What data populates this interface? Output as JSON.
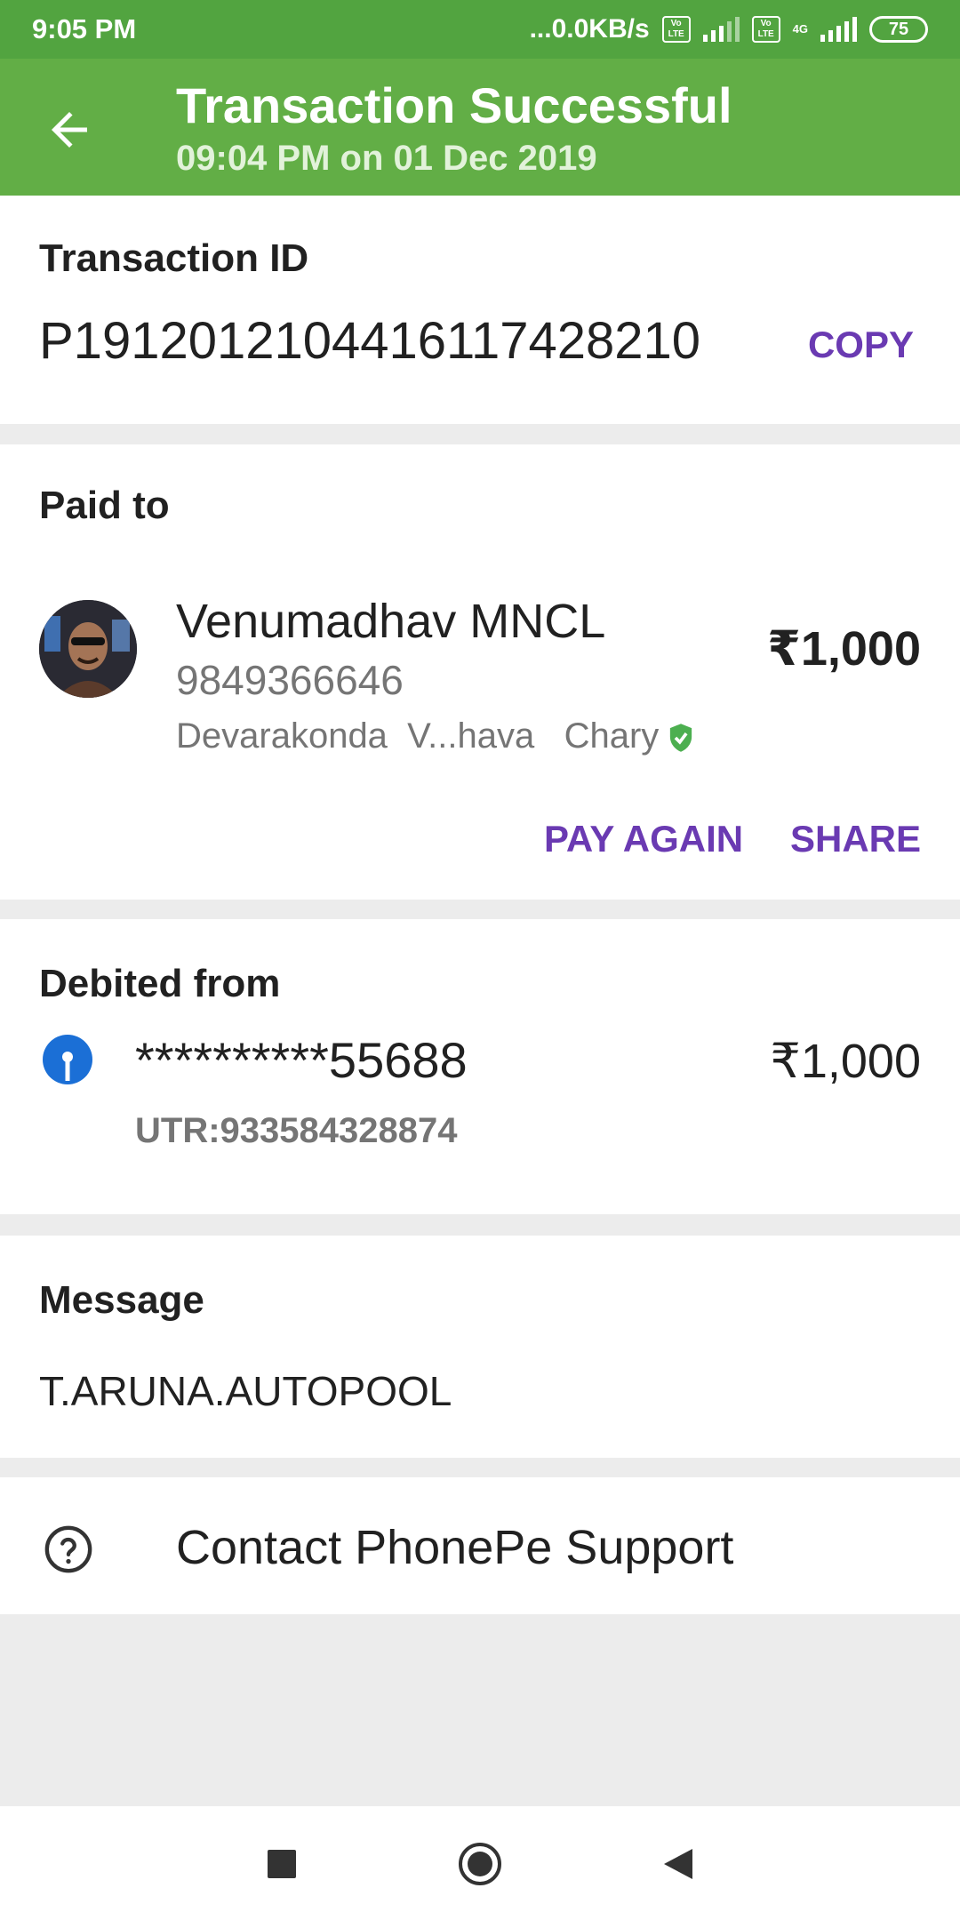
{
  "status_bar": {
    "time": "9:05 PM",
    "net_speed": "...0.0KB/s",
    "sim1_tag": "Vo LTE",
    "sim2_tag": "Vo LTE",
    "network_type": "4G",
    "battery": "75"
  },
  "header": {
    "title": "Transaction Successful",
    "subtitle": "09:04 PM on 01 Dec 2019",
    "color": "#62ae46"
  },
  "transaction": {
    "label": "Transaction ID",
    "id": "P1912012104416117428210",
    "copy_label": "COPY"
  },
  "paid_to": {
    "label": "Paid to",
    "name": "Venumadhav MNCL",
    "phone": "9849366646",
    "bank_name": "Devarakonda  V...hava   Chary",
    "amount": "₹1,000",
    "pay_again_label": "PAY AGAIN",
    "share_label": "SHARE"
  },
  "debited_from": {
    "label": "Debited from",
    "account": "**********55688",
    "amount": "₹1,000",
    "utr": "UTR:933584328874",
    "bank_icon": "sbi-icon"
  },
  "message": {
    "label": "Message",
    "text": "T.ARUNA.AUTOPOOL"
  },
  "support": {
    "label": "Contact PhonePe Support"
  },
  "colors": {
    "accent": "#6a3ab2",
    "verified": "#4caf50"
  }
}
